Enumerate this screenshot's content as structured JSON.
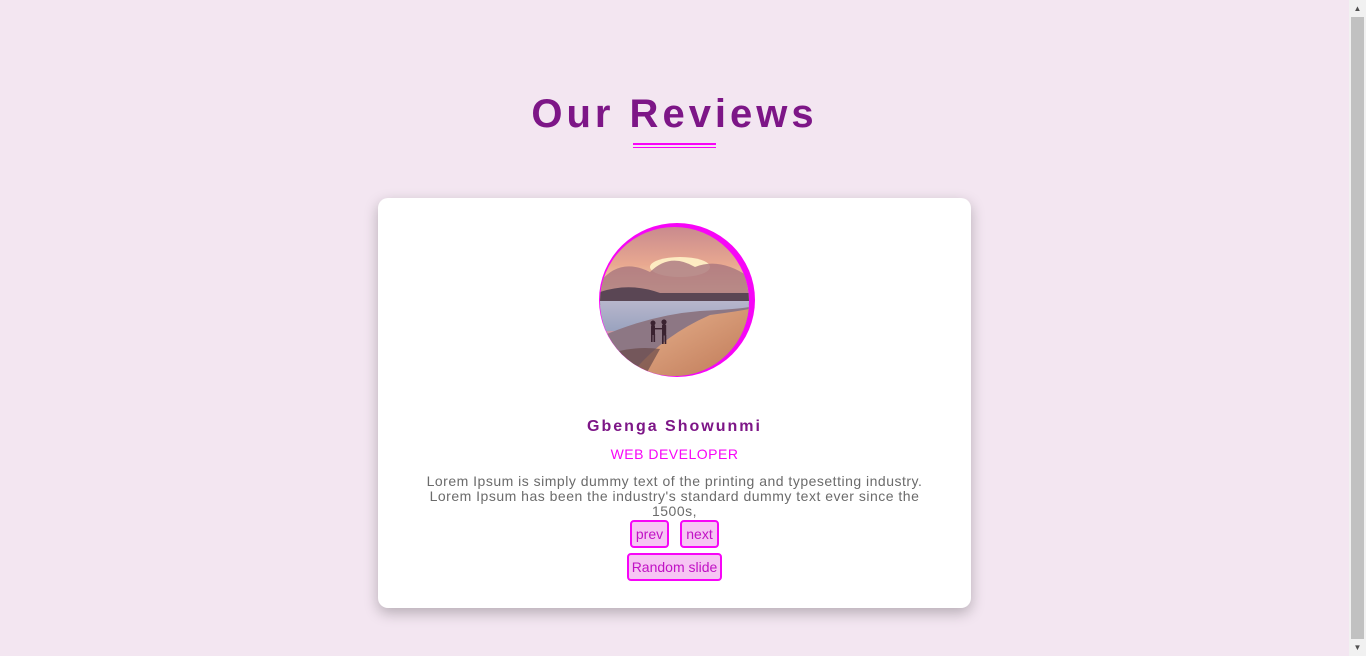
{
  "header": {
    "title": "Our Reviews"
  },
  "review": {
    "author": "Gbenga Showunmi",
    "job": "WEB DEVELOPER",
    "text": "Lorem Ipsum is simply dummy text of the printing and typesetting industry. Lorem Ipsum has been the industry's standard dummy text ever since the 1500s,"
  },
  "buttons": {
    "prev": "prev",
    "next": "next",
    "random": "Random slide"
  },
  "colors": {
    "background": "#f3e6f1",
    "primary": "#7d1687",
    "accent": "#f705f7",
    "button_bg": "#f6c5f3"
  }
}
